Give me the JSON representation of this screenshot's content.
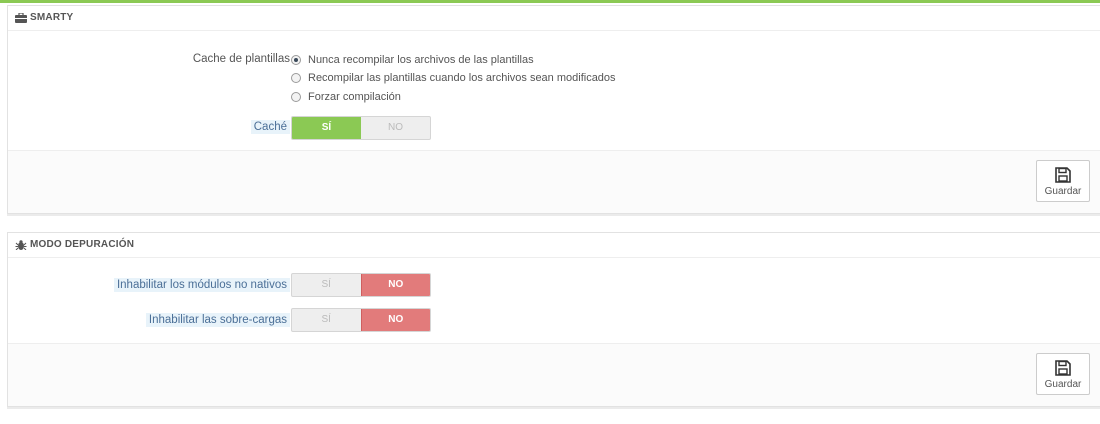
{
  "colors": {
    "accent_green": "#8bc954",
    "danger_red": "#e27b7b",
    "label_hint_bg": "#e8f3fa"
  },
  "smarty": {
    "title": "SMARTY",
    "icon": "briefcase-icon",
    "cache_templates_label": "Cache de plantillas",
    "options": [
      {
        "label": "Nunca recompilar los archivos de las plantillas",
        "checked": true
      },
      {
        "label": "Recompilar las plantillas cuando los archivos sean modificados",
        "checked": false
      },
      {
        "label": "Forzar compilación",
        "checked": false
      }
    ],
    "cache_label": "Caché",
    "cache_yes": "SÍ",
    "cache_no": "NO",
    "save_label": "Guardar"
  },
  "debug": {
    "title": "MODO DEPURACIÓN",
    "icon": "bug-icon",
    "disable_modules_label": "Inhabilitar los módulos no nativos",
    "disable_modules_yes": "SÍ",
    "disable_modules_no": "NO",
    "disable_overrides_label": "Inhabilitar las sobre-cargas",
    "disable_overrides_yes": "SÍ",
    "disable_overrides_no": "NO",
    "save_label": "Guardar"
  }
}
